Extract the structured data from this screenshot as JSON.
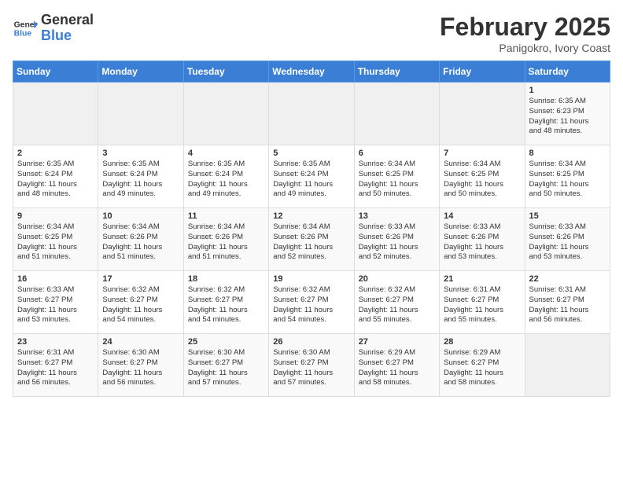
{
  "header": {
    "logo": {
      "general": "General",
      "blue": "Blue"
    },
    "title": "February 2025",
    "location": "Panigokro, Ivory Coast"
  },
  "weekdays": [
    "Sunday",
    "Monday",
    "Tuesday",
    "Wednesday",
    "Thursday",
    "Friday",
    "Saturday"
  ],
  "weeks": [
    [
      {
        "day": "",
        "info": ""
      },
      {
        "day": "",
        "info": ""
      },
      {
        "day": "",
        "info": ""
      },
      {
        "day": "",
        "info": ""
      },
      {
        "day": "",
        "info": ""
      },
      {
        "day": "",
        "info": ""
      },
      {
        "day": "1",
        "info": "Sunrise: 6:35 AM\nSunset: 6:23 PM\nDaylight: 11 hours\nand 48 minutes."
      }
    ],
    [
      {
        "day": "2",
        "info": "Sunrise: 6:35 AM\nSunset: 6:24 PM\nDaylight: 11 hours\nand 48 minutes."
      },
      {
        "day": "3",
        "info": "Sunrise: 6:35 AM\nSunset: 6:24 PM\nDaylight: 11 hours\nand 49 minutes."
      },
      {
        "day": "4",
        "info": "Sunrise: 6:35 AM\nSunset: 6:24 PM\nDaylight: 11 hours\nand 49 minutes."
      },
      {
        "day": "5",
        "info": "Sunrise: 6:35 AM\nSunset: 6:24 PM\nDaylight: 11 hours\nand 49 minutes."
      },
      {
        "day": "6",
        "info": "Sunrise: 6:34 AM\nSunset: 6:25 PM\nDaylight: 11 hours\nand 50 minutes."
      },
      {
        "day": "7",
        "info": "Sunrise: 6:34 AM\nSunset: 6:25 PM\nDaylight: 11 hours\nand 50 minutes."
      },
      {
        "day": "8",
        "info": "Sunrise: 6:34 AM\nSunset: 6:25 PM\nDaylight: 11 hours\nand 50 minutes."
      }
    ],
    [
      {
        "day": "9",
        "info": "Sunrise: 6:34 AM\nSunset: 6:25 PM\nDaylight: 11 hours\nand 51 minutes."
      },
      {
        "day": "10",
        "info": "Sunrise: 6:34 AM\nSunset: 6:26 PM\nDaylight: 11 hours\nand 51 minutes."
      },
      {
        "day": "11",
        "info": "Sunrise: 6:34 AM\nSunset: 6:26 PM\nDaylight: 11 hours\nand 51 minutes."
      },
      {
        "day": "12",
        "info": "Sunrise: 6:34 AM\nSunset: 6:26 PM\nDaylight: 11 hours\nand 52 minutes."
      },
      {
        "day": "13",
        "info": "Sunrise: 6:33 AM\nSunset: 6:26 PM\nDaylight: 11 hours\nand 52 minutes."
      },
      {
        "day": "14",
        "info": "Sunrise: 6:33 AM\nSunset: 6:26 PM\nDaylight: 11 hours\nand 53 minutes."
      },
      {
        "day": "15",
        "info": "Sunrise: 6:33 AM\nSunset: 6:26 PM\nDaylight: 11 hours\nand 53 minutes."
      }
    ],
    [
      {
        "day": "16",
        "info": "Sunrise: 6:33 AM\nSunset: 6:27 PM\nDaylight: 11 hours\nand 53 minutes."
      },
      {
        "day": "17",
        "info": "Sunrise: 6:32 AM\nSunset: 6:27 PM\nDaylight: 11 hours\nand 54 minutes."
      },
      {
        "day": "18",
        "info": "Sunrise: 6:32 AM\nSunset: 6:27 PM\nDaylight: 11 hours\nand 54 minutes."
      },
      {
        "day": "19",
        "info": "Sunrise: 6:32 AM\nSunset: 6:27 PM\nDaylight: 11 hours\nand 54 minutes."
      },
      {
        "day": "20",
        "info": "Sunrise: 6:32 AM\nSunset: 6:27 PM\nDaylight: 11 hours\nand 55 minutes."
      },
      {
        "day": "21",
        "info": "Sunrise: 6:31 AM\nSunset: 6:27 PM\nDaylight: 11 hours\nand 55 minutes."
      },
      {
        "day": "22",
        "info": "Sunrise: 6:31 AM\nSunset: 6:27 PM\nDaylight: 11 hours\nand 56 minutes."
      }
    ],
    [
      {
        "day": "23",
        "info": "Sunrise: 6:31 AM\nSunset: 6:27 PM\nDaylight: 11 hours\nand 56 minutes."
      },
      {
        "day": "24",
        "info": "Sunrise: 6:30 AM\nSunset: 6:27 PM\nDaylight: 11 hours\nand 56 minutes."
      },
      {
        "day": "25",
        "info": "Sunrise: 6:30 AM\nSunset: 6:27 PM\nDaylight: 11 hours\nand 57 minutes."
      },
      {
        "day": "26",
        "info": "Sunrise: 6:30 AM\nSunset: 6:27 PM\nDaylight: 11 hours\nand 57 minutes."
      },
      {
        "day": "27",
        "info": "Sunrise: 6:29 AM\nSunset: 6:27 PM\nDaylight: 11 hours\nand 58 minutes."
      },
      {
        "day": "28",
        "info": "Sunrise: 6:29 AM\nSunset: 6:27 PM\nDaylight: 11 hours\nand 58 minutes."
      },
      {
        "day": "",
        "info": ""
      }
    ]
  ]
}
